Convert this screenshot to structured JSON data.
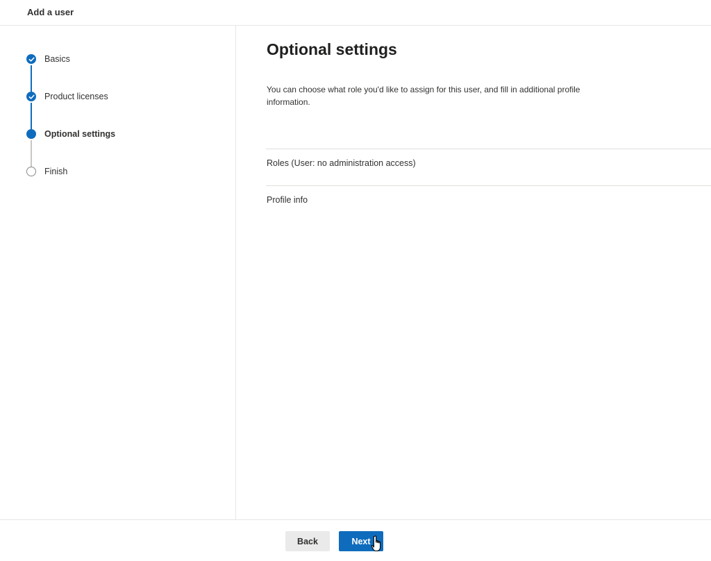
{
  "header": {
    "title": "Add a user"
  },
  "steps": [
    {
      "label": "Basics",
      "state": "done"
    },
    {
      "label": "Product licenses",
      "state": "done"
    },
    {
      "label": "Optional settings",
      "state": "current"
    },
    {
      "label": "Finish",
      "state": "pending"
    }
  ],
  "main": {
    "title": "Optional settings",
    "description": "You can choose what role you'd like to assign for this user, and fill in additional profile information.",
    "sections": [
      {
        "label": "Roles (User: no administration access)"
      },
      {
        "label": "Profile info"
      }
    ]
  },
  "footer": {
    "back_label": "Back",
    "next_label": "Next"
  },
  "colors": {
    "accent": "#0f6cbd",
    "pending_ring": "#8a8886",
    "back_button_bg": "#eaeaea"
  },
  "icons": {
    "done": "checkmark-icon",
    "cursor": "hand-pointer-cursor-icon"
  }
}
